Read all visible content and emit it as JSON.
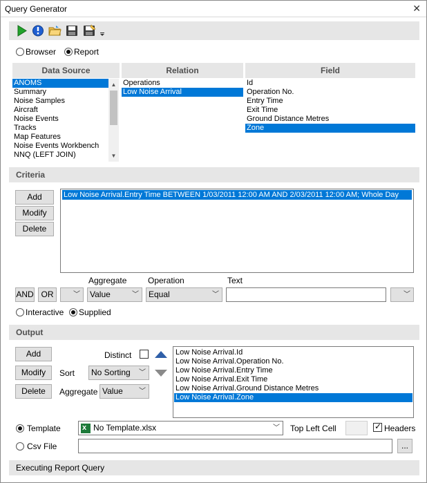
{
  "window": {
    "title": "Query Generator"
  },
  "mode": {
    "browser_label": "Browser",
    "report_label": "Report",
    "selected": "Report"
  },
  "data_source": {
    "header": "Data Source",
    "items": [
      "ANOMS",
      "Summary",
      "Noise Samples",
      "Aircraft",
      "Noise Events",
      "Tracks",
      "Map Features",
      "Noise Events Workbench",
      "NNQ (LEFT JOIN)"
    ],
    "selected_index": 0
  },
  "relation": {
    "header": "Relation",
    "items": [
      "Operations",
      "Low Noise Arrival"
    ],
    "selected_index": 1
  },
  "field": {
    "header": "Field",
    "items": [
      "Id",
      "Operation No.",
      "Entry Time",
      "Exit Time",
      "Ground Distance Metres",
      "Zone"
    ],
    "selected_index": 5
  },
  "criteria": {
    "header": "Criteria",
    "add_label": "Add",
    "modify_label": "Modify",
    "delete_label": "Delete",
    "items": [
      "Low Noise Arrival.Entry Time BETWEEN 1/03/2011 12:00 AM AND 2/03/2011 12:00 AM; Whole Day"
    ],
    "and_label": "AND",
    "or_label": "OR",
    "aggregate_label": "Aggregate",
    "aggregate_value": "Value",
    "operation_label": "Operation",
    "operation_value": "Equal",
    "text_label": "Text",
    "text_value": "",
    "interactive_label": "Interactive",
    "supplied_label": "Supplied",
    "selected_mode": "Supplied"
  },
  "output": {
    "header": "Output",
    "add_label": "Add",
    "modify_label": "Modify",
    "delete_label": "Delete",
    "distinct_label": "Distinct",
    "distinct_checked": false,
    "sort_label": "Sort",
    "sort_value": "No Sorting",
    "aggregate_label": "Aggregate",
    "aggregate_value": "Value",
    "items": [
      "Low Noise Arrival.Id",
      "Low Noise Arrival.Operation No.",
      "Low Noise Arrival.Entry Time",
      "Low Noise Arrival.Exit Time",
      "Low Noise Arrival.Ground Distance Metres",
      "Low Noise Arrival.Zone"
    ],
    "selected_index": 5,
    "template_label": "Template",
    "template_value": "No Template.xlsx",
    "top_left_cell_label": "Top Left Cell",
    "top_left_cell_value": "",
    "headers_label": "Headers",
    "headers_checked": true,
    "csv_label": "Csv File",
    "csv_value": "",
    "browse_label": "...",
    "selected_target": "Template"
  },
  "status": {
    "text": "Executing Report Query"
  },
  "icons": [
    "run-icon",
    "info-icon",
    "open-folder-icon",
    "save-icon",
    "save-as-icon",
    "overflow-icon"
  ],
  "colors": {
    "selection": "#0078d7",
    "panel": "#e6e6e6",
    "accent_arrow": "#2f5fa8"
  }
}
